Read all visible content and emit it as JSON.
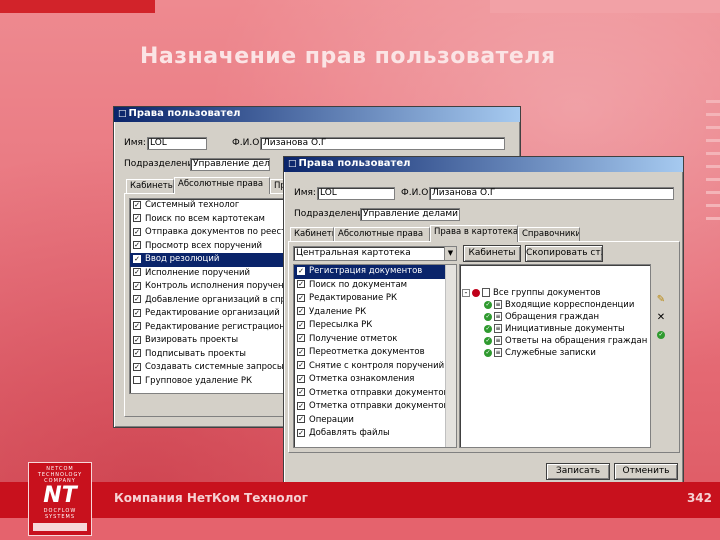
{
  "slide": {
    "title": "Назначение прав пользователя",
    "footer_text": "Компания НетКом Технолог",
    "footer_page": "342",
    "logo_lines": [
      "NETCOM",
      "TECHNOLOGY",
      "COMPANY"
    ],
    "logo_mark": "NT",
    "logo_bottom_lines": [
      "DOCFLOW",
      "SYSTEMS"
    ]
  },
  "back_window": {
    "title": "Права пользовател",
    "name_label": "Имя:",
    "name_value": "LOL",
    "fio_label": "Ф.И.О.:",
    "fio_value": "Лизанова О.Г",
    "dept_label": "Подразделение:",
    "dept_value": "Управление делами",
    "tabs": [
      "Кабинеты",
      "Абсолютные права",
      "Пр"
    ],
    "rights": [
      {
        "label": "Системный технолог",
        "checked": true
      },
      {
        "label": "Поиск по всем картотекам",
        "checked": true
      },
      {
        "label": "Отправка документов по реестрам",
        "checked": true
      },
      {
        "label": "Просмотр всех поручений",
        "checked": true
      },
      {
        "label": "Ввод резолюций",
        "checked": true,
        "selected": true
      },
      {
        "label": "Исполнение поручений",
        "checked": true
      },
      {
        "label": "Контроль исполнения поручений",
        "checked": true
      },
      {
        "label": "Добавление организаций в справ",
        "checked": true
      },
      {
        "label": "Редактирование организаций в спр",
        "checked": true
      },
      {
        "label": "Редактирование регистрационных",
        "checked": true
      },
      {
        "label": "Визировать проекты",
        "checked": true
      },
      {
        "label": "Подписывать проекты",
        "checked": true
      },
      {
        "label": "Создавать системные запросы",
        "checked": true
      },
      {
        "label": "Групповое удаление РК",
        "checked": false
      }
    ]
  },
  "front_window": {
    "title": "Права пользовател",
    "name_label": "Имя:",
    "name_value": "LOL",
    "fio_label": "Ф.И.О.:",
    "fio_value": "Лизанова О.Г",
    "dept_label": "Подразделение:",
    "dept_value": "Управление делами",
    "tabs": [
      "Кабинеты",
      "Абсолютные права",
      "Права в картотеках",
      "Справочники"
    ],
    "card_combo": "Центральная картотека",
    "cabinets_button": "Кабинеты",
    "copy_button": "Скопировать ст...",
    "rights": [
      {
        "label": "Регистрация документов",
        "checked": true,
        "selected": true
      },
      {
        "label": "Поиск по документам",
        "checked": true
      },
      {
        "label": "Редактирование РК",
        "checked": true
      },
      {
        "label": "Удаление РК",
        "checked": true
      },
      {
        "label": "Пересылка РК",
        "checked": true
      },
      {
        "label": "Получение отметок",
        "checked": true
      },
      {
        "label": "Переотметка документов",
        "checked": true
      },
      {
        "label": "Снятие с контроля поручений",
        "checked": true
      },
      {
        "label": "Отметка ознакомления",
        "checked": true
      },
      {
        "label": "Отметка отправки документов",
        "checked": true
      },
      {
        "label": "Отметка отправки документов",
        "checked": true
      },
      {
        "label": "Операции",
        "checked": true
      },
      {
        "label": "Добавлять файлы",
        "checked": true
      }
    ],
    "tree_root": "Все группы документов",
    "tree_children": [
      "Входящие корреспонденции",
      "Обращения граждан",
      "Инициативные документы",
      "Ответы на обращения граждан",
      "Служебные записки"
    ],
    "save_button": "Записать",
    "cancel_button": "Отменить"
  }
}
